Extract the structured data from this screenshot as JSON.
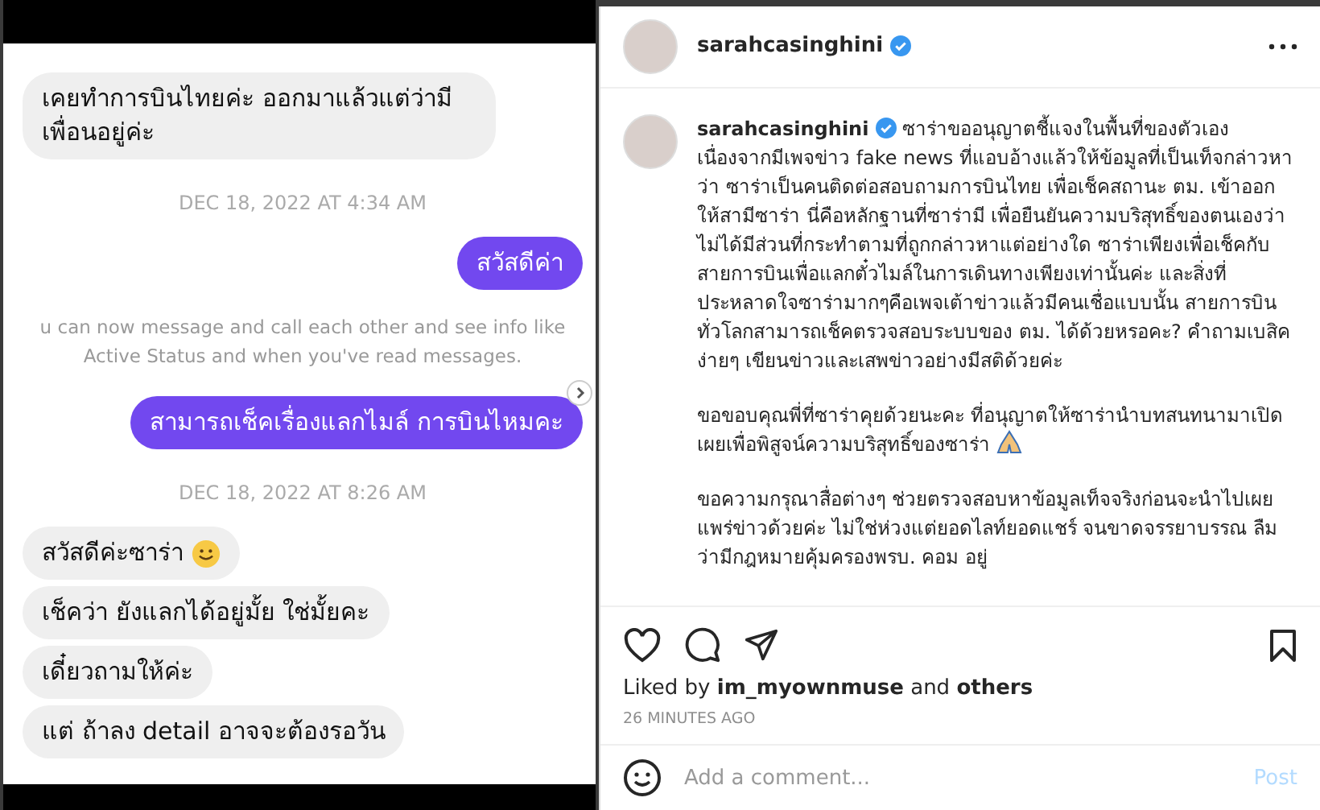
{
  "chat": {
    "messages": [
      {
        "kind": "incoming",
        "text": "เคยทำการบินไทยค่ะ ออกมาแล้วแต่ว่ามีเพื่อนอยู่ค่ะ"
      },
      {
        "kind": "date",
        "text": "DEC 18, 2022 AT 4:34 AM"
      },
      {
        "kind": "outgoing",
        "text": "สวัสดีค่า"
      },
      {
        "kind": "notice",
        "lines": [
          "u can now message and call each other and see info like",
          "Active Status and when you've read messages."
        ]
      },
      {
        "kind": "outgoing",
        "text": "สามารถเช็คเรื่องแลกไมล์ การบินไหมคะ",
        "forward": true
      },
      {
        "kind": "date",
        "text": "DEC 18, 2022 AT 8:26 AM"
      },
      {
        "kind": "incoming",
        "text": "สวัสดีค่ะซาร่า",
        "emoji": true
      },
      {
        "kind": "incoming",
        "text": "เช็คว่า ยังแลกได้อยู่มั้ย ใช่มั้ยคะ"
      },
      {
        "kind": "incoming",
        "text": "เดี๋ยวถามให้ค่ะ"
      },
      {
        "kind": "incoming",
        "text": "แต่ ถ้าลง detail อาจจะต้องรอวัน"
      }
    ]
  },
  "post": {
    "header": {
      "username": "sarahcasinghini",
      "verified": true
    },
    "caption": {
      "username": "sarahcasinghini",
      "verified": true,
      "paragraphs": [
        {
          "text": "ซาร่าขออนุญาตชี้แจงในพื้นที่ของตัวเอง เนื่องจากมีเพจข่าว fake news ที่แอบอ้างแล้วให้ข้อมูลที่เป็นเท็จกล่าวหาว่า ซาร่าเป็นคนติดต่อสอบถามการบินไทย เพื่อเช็คสถานะ ตม. เข้าออกให้สามีซาร่า นี่คือหลักฐานที่ซาร่ามี เพื่อยืนยันความบริสุทธิ์ของตนเองว่าไม่ได้มีส่วนที่กระทำตามที่ถูกกล่าวหาแต่อย่างใด ซาร่าเพียงเพื่อเช็คกับสายการบินเพื่อแลกตั๋วไมล์ในการเดินทางเพียงเท่านั้นค่ะ และสิ่งที่ประหลาดใจซาร่ามากๆคือเพจเต้าข่าวแล้วมีคนเชื่อแบบนั้น สายการบินทั่วโลกสามารถเช็คตรวจสอบระบบของ ตม. ได้ด้วยหรอคะ? คำถามเบสิคง่ายๆ เขียนข่าวและเสพข่าวอย่างมีสติด้วยค่ะ"
        },
        {
          "text": "ขอขอบคุณพี่ที่ซาร่าคุยด้วยนะคะ ที่อนุญาตให้ซาร่านำบทสนทนามาเปิดเผยเพื่อพิสูจน์ความบริสุทธิ์ของซาร่า",
          "emoji": true
        },
        {
          "text": "ขอความกรุณาสื่อต่างๆ ช่วยตรวจสอบหาข้อมูลเท็จจริงก่อนจะนำไปเผยแพร่ข่าวด้วยค่ะ ไม่ใช่ห่วงแต่ยอดไลท์ยอดแชร์ จนขาดจรรยาบรรณ ลืมว่ามีกฎหมายคุ้มครองพรบ. คอม อยู่"
        }
      ]
    },
    "liked_by": "Liked by **im_myownmuse** and **others**",
    "time": "26 MINUTES AGO",
    "comment": {
      "placeholder": "Add a comment..."
    },
    "post_button": "Post"
  }
}
